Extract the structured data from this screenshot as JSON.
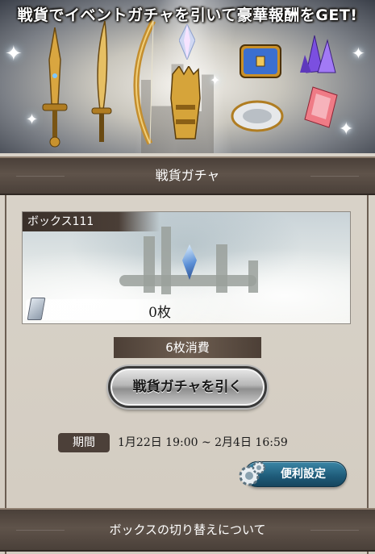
{
  "banner": {
    "title": "戦貨でイベントガチャを引いて豪華報酬をGET!"
  },
  "gacha": {
    "header": "戦貨ガチャ",
    "box_label": "ボックス111",
    "ticket_count": "0枚",
    "cost_label": "6枚消費",
    "draw_button": "戦貨ガチャを引く",
    "period_label": "期間",
    "period_value": "1月22日 19:00 ~ 2月4日 16:59",
    "settings_button": "便利設定"
  },
  "footer": {
    "box_switch_header": "ボックスの切り替えについて"
  },
  "colors": {
    "header_bg": "#4a4039",
    "settings_accent": "#1e5a78",
    "panel_bg": "#d7d0c6"
  }
}
